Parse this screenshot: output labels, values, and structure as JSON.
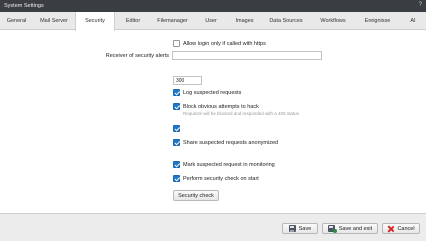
{
  "window": {
    "title": "System Settings",
    "help": "?"
  },
  "tabs": [
    {
      "label": "General"
    },
    {
      "label": "Mail Server"
    },
    {
      "label": "Security",
      "active": true
    },
    {
      "label": "Editor"
    },
    {
      "label": "Filemanager"
    },
    {
      "label": "User"
    },
    {
      "label": "Images"
    },
    {
      "label": "Data Sources"
    },
    {
      "label": "Workflows"
    },
    {
      "label": "Ereignisse"
    },
    {
      "label": "AI"
    }
  ],
  "security": {
    "https_only": {
      "label": "Allow login only if called with https",
      "checked": false
    },
    "receiver": {
      "label": "Receiver of security alerts",
      "value": "",
      "placeholder": ""
    },
    "threshold": {
      "value": "300"
    },
    "log_suspected": {
      "label": "Log suspected requests",
      "checked": true
    },
    "block_obvious": {
      "label": "Block obvious attempts to hack",
      "checked": true,
      "hint": "Requests will be blocked and responded with a 400 status"
    },
    "unlabeled": {
      "checked": true
    },
    "share_anonymized": {
      "label": "Share suspected requests anonymized",
      "checked": true
    },
    "mark_monitoring": {
      "label": "Mark suspected request in monitoring",
      "checked": true
    },
    "perform_check": {
      "label": "Perform security check on start",
      "checked": true
    },
    "check_button": "Security check"
  },
  "footer": {
    "save": "Save",
    "save_exit": "Save and exit",
    "cancel": "Cancel"
  },
  "colors": {
    "titlebar": "#3a3d42",
    "checkbox_checked": "#1f78c8",
    "cancel_icon": "#d12a2a"
  },
  "icons": {
    "save": "floppy-disk-icon",
    "save_exit": "floppy-disk-exit-icon",
    "cancel": "close-icon"
  }
}
